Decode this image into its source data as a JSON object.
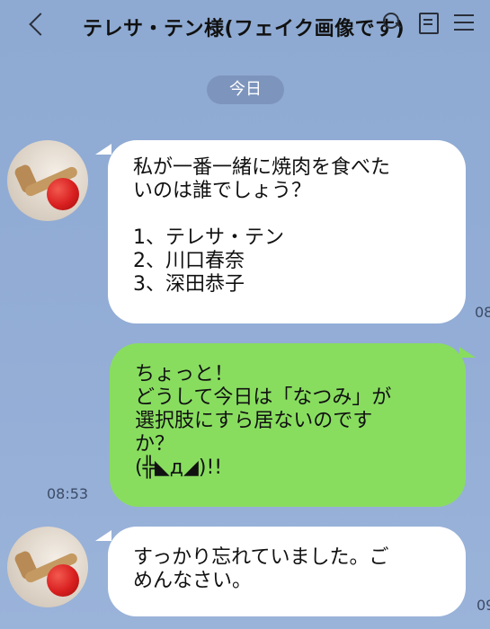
{
  "header": {
    "title": "テレサ・テン様(フェイク画像です)",
    "icons": [
      "back-icon",
      "search-icon",
      "call-icon",
      "menu-icon"
    ]
  },
  "date_separator": "今日",
  "messages": [
    {
      "sender": "other",
      "text": "私が一番一緒に焼肉を食べた\nいのは誰でしょう？\n\n1、テレサ・テン\n2、川口春奈\n3、深田恭子",
      "time": "08"
    },
    {
      "sender": "me",
      "text": "ちょっと！\nどうして今日は「なつみ」が\n選択肢にすら居ないのです\nか？\n(╬◣д◢)!!",
      "time": "08:53"
    },
    {
      "sender": "other",
      "text": "すっかり忘れていました。ご\nめんなさい。",
      "time": "09"
    }
  ],
  "colors": {
    "background": "#93add6",
    "my_bubble": "#88dd5f",
    "their_bubble": "#ffffff",
    "date_pill": "#7d95bd"
  }
}
